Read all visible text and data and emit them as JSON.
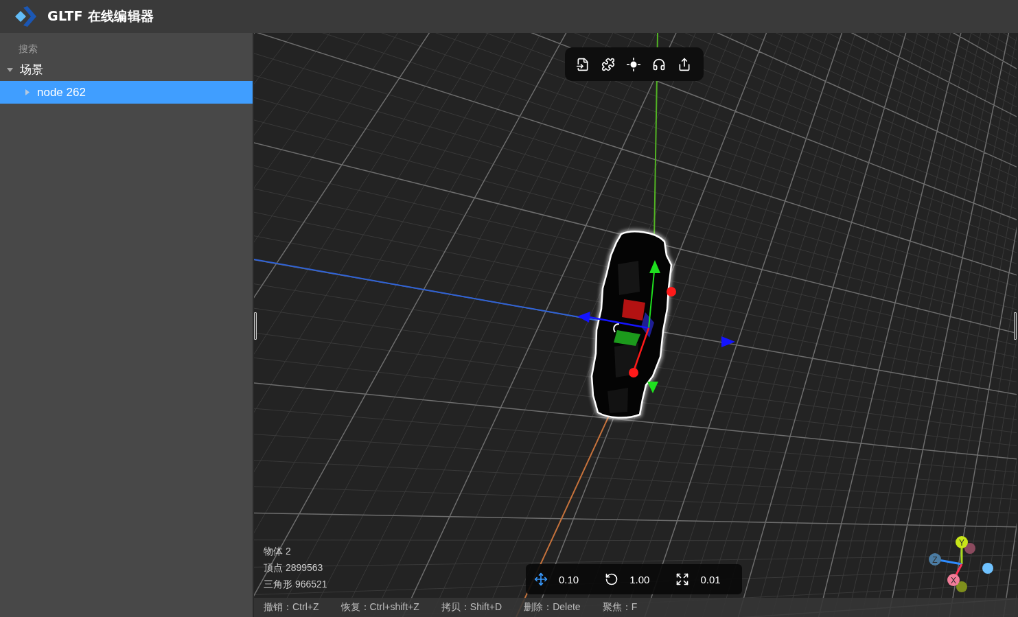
{
  "app": {
    "title": "GLTF 在线编辑器"
  },
  "sidebar": {
    "search": {
      "placeholder": "搜索"
    },
    "tree": [
      {
        "label": "场景",
        "expanded": true,
        "selected": false,
        "children": [
          {
            "label": "node 262",
            "expanded": false,
            "selected": true
          }
        ]
      }
    ]
  },
  "viewport": {
    "stats": [
      "物体 2",
      "顶点 2899563",
      "三角形 966521"
    ],
    "snap_bar": [
      {
        "kind": "translate",
        "value": "0.10"
      },
      {
        "kind": "rotate",
        "value": "1.00"
      },
      {
        "kind": "scale",
        "value": "0.01"
      }
    ],
    "shortcuts": [
      "撤销：Ctrl+Z",
      "恢复：Ctrl+shift+Z",
      "拷贝：Shift+D",
      "删除：Delete",
      "聚焦：F"
    ],
    "axis_gizmo": [
      {
        "label": "Y",
        "color": "#c8e619"
      },
      {
        "label": "Z",
        "color": "#4b7ca3"
      },
      {
        "label": "X",
        "color": "#f27c98"
      }
    ]
  }
}
